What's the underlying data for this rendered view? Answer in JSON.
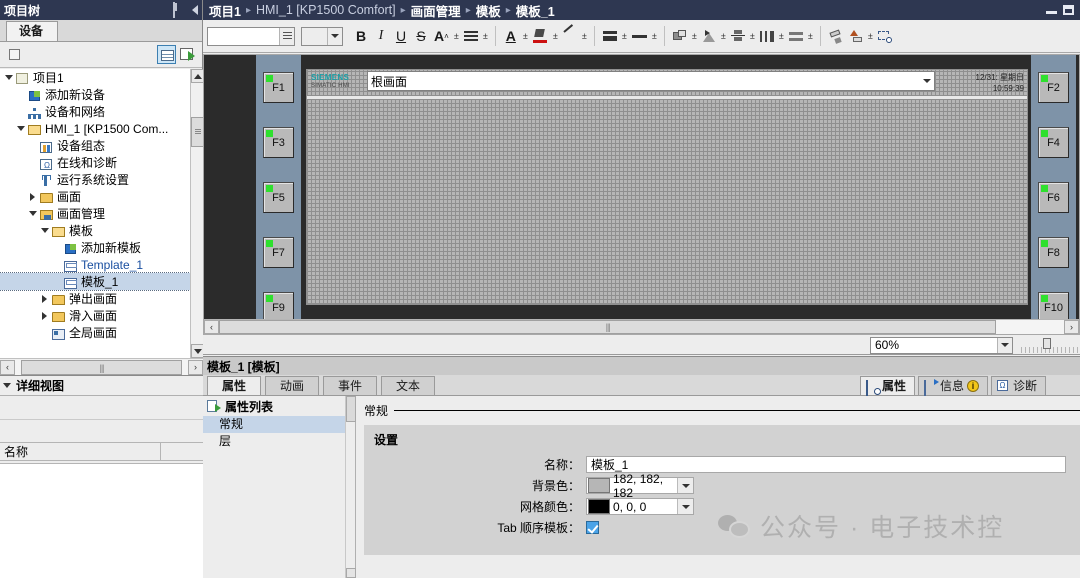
{
  "window": {
    "minimize_icon": "minimize-icon",
    "restore_icon": "restore-icon"
  },
  "project_tree": {
    "panel_title": "项目树",
    "dock_icon": "dock-icon",
    "collapse_icon": "caret-left-icon",
    "tab_label": "设备",
    "toolbar": {
      "bookmark_icon": "bookmark-icon",
      "grid_view_icon": "grid-view-icon",
      "add_view_icon": "add-view-icon"
    },
    "items": [
      {
        "label": "项目1",
        "indent": 0,
        "twisty": "down",
        "icon": "project-icon",
        "selected": false,
        "blue": false
      },
      {
        "label": "添加新设备",
        "indent": 1,
        "twisty": "none",
        "icon": "add-device-icon",
        "selected": false,
        "blue": false
      },
      {
        "label": "设备和网络",
        "indent": 1,
        "twisty": "none",
        "icon": "devices-network-icon",
        "selected": false,
        "blue": false
      },
      {
        "label": "HMI_1 [KP1500 Com...",
        "indent": 1,
        "twisty": "down",
        "icon": "folder-open-icon",
        "selected": false,
        "blue": false
      },
      {
        "label": "设备组态",
        "indent": 2,
        "twisty": "none",
        "icon": "device-config-icon",
        "selected": false,
        "blue": false
      },
      {
        "label": "在线和诊断",
        "indent": 2,
        "twisty": "none",
        "icon": "online-diag-icon",
        "selected": false,
        "blue": false
      },
      {
        "label": "运行系统设置",
        "indent": 2,
        "twisty": "none",
        "icon": "runtime-settings-icon",
        "selected": false,
        "blue": false
      },
      {
        "label": "画面",
        "indent": 2,
        "twisty": "right",
        "icon": "screens-folder-icon",
        "selected": false,
        "blue": false
      },
      {
        "label": "画面管理",
        "indent": 2,
        "twisty": "down",
        "icon": "screen-mgmt-icon",
        "selected": false,
        "blue": false
      },
      {
        "label": "模板",
        "indent": 3,
        "twisty": "down",
        "icon": "template-folder-icon",
        "selected": false,
        "blue": false
      },
      {
        "label": "添加新模板",
        "indent": 4,
        "twisty": "none",
        "icon": "add-template-icon",
        "selected": false,
        "blue": false
      },
      {
        "label": "Template_1",
        "indent": 4,
        "twisty": "none",
        "icon": "template-icon",
        "selected": false,
        "blue": true
      },
      {
        "label": "模板_1",
        "indent": 4,
        "twisty": "none",
        "icon": "template-icon",
        "selected": true,
        "blue": false
      },
      {
        "label": "弹出画面",
        "indent": 3,
        "twisty": "right",
        "icon": "popup-screen-icon",
        "selected": false,
        "blue": false
      },
      {
        "label": "滑入画面",
        "indent": 3,
        "twisty": "right",
        "icon": "slidein-screen-icon",
        "selected": false,
        "blue": false
      },
      {
        "label": "全局画面",
        "indent": 3,
        "twisty": "none",
        "icon": "global-screen-icon",
        "selected": false,
        "blue": false
      }
    ],
    "scroll": {
      "up_icon": "chevron-up-icon",
      "down_icon": "chevron-down-icon",
      "left_icon": "chevron-left-icon",
      "right_icon": "chevron-right-icon"
    }
  },
  "detail_view": {
    "title": "详细视图",
    "collapse_icon": "caret-down-icon",
    "column_header": "名称"
  },
  "header": {
    "breadcrumb": [
      {
        "label": "项目1",
        "dim": false
      },
      {
        "label": "HMI_1 [KP1500 Comfort]",
        "dim": true
      },
      {
        "label": "画面管理",
        "dim": false
      },
      {
        "label": "模板",
        "dim": false
      },
      {
        "label": "模板_1",
        "dim": false
      }
    ],
    "separator": "▸"
  },
  "toolbar": {
    "font_value": "",
    "font_placeholder": "",
    "size_value": "",
    "buttons": [
      {
        "name": "bold-button",
        "glyph": "B",
        "style": "bold"
      },
      {
        "name": "italic-button",
        "glyph": "I",
        "style": "ital"
      },
      {
        "name": "underline-button",
        "glyph": "U",
        "style": "und"
      },
      {
        "name": "strikethrough-button",
        "glyph": "S",
        "style": "strk"
      }
    ],
    "font_color_label": "A",
    "icons": [
      "font-size-icon",
      "align-text-icon",
      "font-color-icon",
      "fill-color-icon",
      "line-color-icon",
      "align-icon",
      "line-width-icon",
      "bring-to-front-icon",
      "rotate-icon",
      "align-vertical-icon",
      "distribute-horizontal-icon",
      "distribute-vertical-icon",
      "format-painter-icon",
      "order-icon",
      "zoom-select-icon"
    ]
  },
  "canvas": {
    "device": {
      "brand_line1": "SIEMENS",
      "brand_line2": "SIMATIC HMI",
      "screen_title": "根画面",
      "dropdown_icon": "chevron-down-icon",
      "datetime_date": "12/31: 星期日",
      "datetime_time": "10:59:39",
      "function_keys_left": [
        "F1",
        "F3",
        "F5",
        "F7",
        "F9"
      ],
      "function_keys_right": [
        "F2",
        "F4",
        "F6",
        "F8",
        "F10"
      ]
    },
    "zoom_value": "60%",
    "zoom_dropdown_icon": "chevron-down-icon",
    "hscroll": {
      "left_icon": "chevron-left-icon",
      "right_icon": "chevron-right-icon"
    }
  },
  "properties": {
    "title": "模板_1 [模板]",
    "tabs": [
      {
        "label": "属性",
        "active": true
      },
      {
        "label": "动画",
        "active": false
      },
      {
        "label": "事件",
        "active": false
      },
      {
        "label": "文本",
        "active": false
      }
    ],
    "right_tabs": [
      {
        "label": "属性",
        "icon": "properties-icon",
        "active": true,
        "badge": ""
      },
      {
        "label": "信息",
        "icon": "info-icon",
        "active": false,
        "badge": "i"
      },
      {
        "label": "诊断",
        "icon": "diagnostics-icon",
        "active": false,
        "badge": ""
      }
    ],
    "list_header": "属性列表",
    "list_header_icon": "property-list-icon",
    "list_items": [
      {
        "label": "常规",
        "selected": true
      },
      {
        "label": "层",
        "selected": false
      }
    ],
    "section_title": "常规",
    "group_title": "设置",
    "fields": [
      {
        "type": "text",
        "label": "名称：",
        "value": "模板_1"
      },
      {
        "type": "color",
        "label": "背景色：",
        "value": "182, 182, 182",
        "swatch": "#b6b6b6"
      },
      {
        "type": "color",
        "label": "网格颜色：",
        "value": "0, 0, 0",
        "swatch": "#000000"
      },
      {
        "type": "checkbox",
        "label": "Tab 顺序模板：",
        "value": "",
        "checked": true
      }
    ]
  },
  "watermark": {
    "text": "公众号 · 电子技术控",
    "icon": "wechat-icon"
  },
  "colors": {
    "title_bar": "#2e3751",
    "selection": "#c5d5e8",
    "panel_bg": "#ededed",
    "group_bg": "#d2d2d2",
    "hmi_bezel": "#7e93a8",
    "led_green": "#2ee02e",
    "siemens_teal": "#1aa0a8"
  }
}
